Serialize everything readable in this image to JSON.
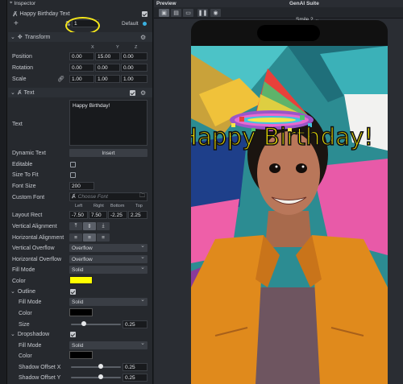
{
  "inspector": {
    "title": "Inspector",
    "object_name": "Happy Birthday Text",
    "layer_value": "1",
    "layer_label": "Default",
    "transform": {
      "title": "Transform",
      "axes": [
        "X",
        "Y",
        "Z"
      ],
      "position_label": "Position",
      "rotation_label": "Rotation",
      "scale_label": "Scale",
      "position": [
        "0.00",
        "15.00",
        "0.00"
      ],
      "rotation": [
        "0.00",
        "0.00",
        "0.00"
      ],
      "scale": [
        "1.00",
        "1.00",
        "1.00"
      ]
    },
    "text": {
      "title": "Text",
      "text_label": "Text",
      "text_value": "Happy Birthday!",
      "dynamic_text_label": "Dynamic Text",
      "insert_label": "Insert",
      "editable_label": "Editable",
      "size_to_fit_label": "Size To Fit",
      "font_size_label": "Font Size",
      "font_size_value": "200",
      "custom_font_label": "Custom Font",
      "choose_font_placeholder": "Choose Font",
      "layout_rect_label": "Layout Rect",
      "rect_headers": [
        "Left",
        "Right",
        "Bottom",
        "Top"
      ],
      "rect_values": [
        "-7.50",
        "7.50",
        "-2.25",
        "2.25"
      ],
      "vertical_alignment_label": "Vertical Alignment",
      "horizontal_alignment_label": "Horizontal Alignment",
      "vertical_overflow_label": "Vertical Overflow",
      "vertical_overflow_value": "Overflow",
      "horizontal_overflow_label": "Horizontal Overflow",
      "horizontal_overflow_value": "Overflow",
      "fill_mode_label": "Fill Mode",
      "fill_mode_value": "Solid",
      "color_label": "Color",
      "color_value": "#ffff00",
      "outline": {
        "title": "Outline",
        "fill_mode_label": "Fill Mode",
        "fill_mode_value": "Solid",
        "color_label": "Color",
        "color_value": "#000000",
        "size_label": "Size",
        "size_value": "0.25",
        "size_level": 0.25
      },
      "dropshadow": {
        "title": "Dropshadow",
        "fill_mode_label": "Fill Mode",
        "fill_mode_value": "Solid",
        "color_label": "Color",
        "color_value": "#000000",
        "offset_x_label": "Shadow Offset X",
        "offset_x_value": "0.25",
        "offset_x_level": 0.6,
        "offset_y_label": "Shadow Offset Y",
        "offset_y_value": "0.25",
        "offset_y_level": 0.6
      }
    }
  },
  "preview": {
    "title": "Preview",
    "panel_title": "GenAI Suite",
    "device": "Smile 2",
    "overlay_text": "Happy Birthday!"
  },
  "colors": {
    "accent_highlight": "#f6e81a",
    "text_yellow": "#f6e600",
    "jacket": "#e08a1c"
  }
}
